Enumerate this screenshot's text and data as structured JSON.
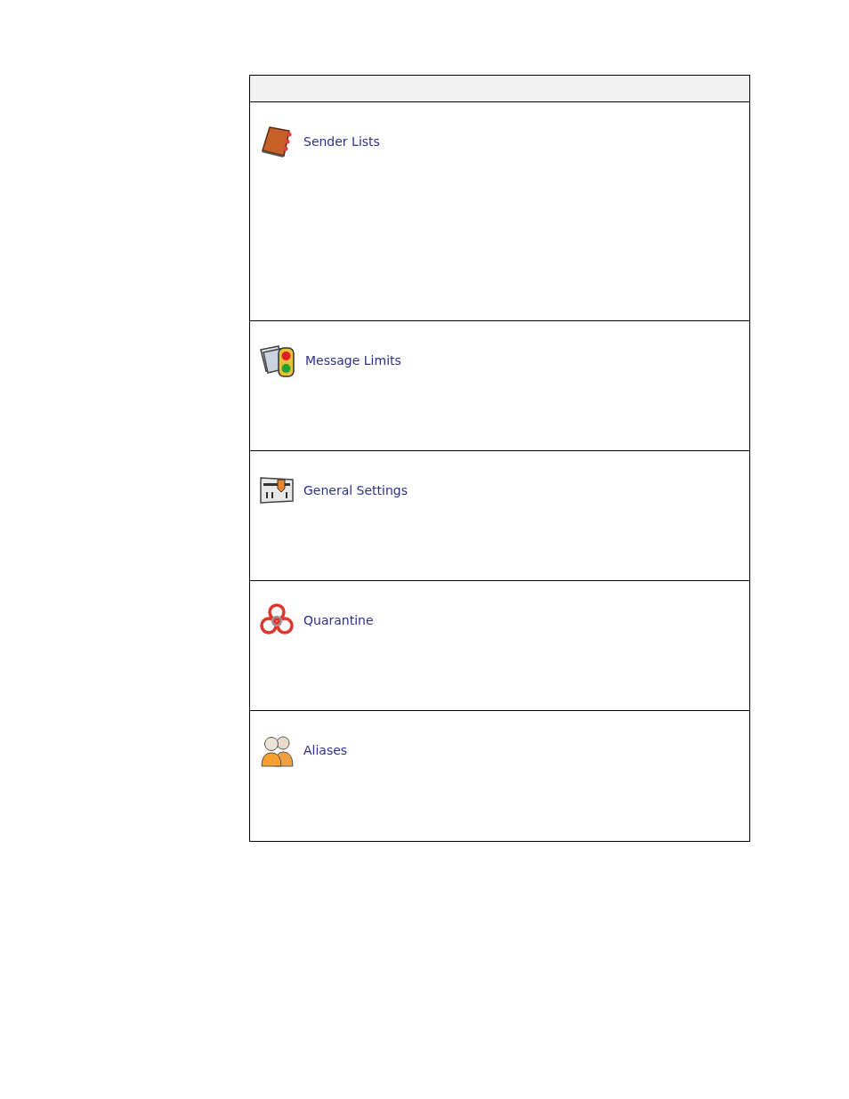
{
  "items": [
    {
      "kind": "book",
      "label": "Sender Lists"
    },
    {
      "kind": "traffic",
      "label": "Message Limits"
    },
    {
      "kind": "slider",
      "label": "General Settings"
    },
    {
      "kind": "biohazard",
      "label": "Quarantine"
    },
    {
      "kind": "people",
      "label": "Aliases"
    }
  ]
}
